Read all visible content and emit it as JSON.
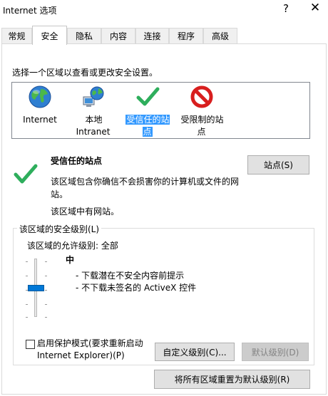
{
  "window": {
    "title": "Internet 选项",
    "help_glyph": "?",
    "close_glyph": "✕"
  },
  "tabs": [
    {
      "label": "常规",
      "active": false
    },
    {
      "label": "安全",
      "active": true
    },
    {
      "label": "隐私",
      "active": false
    },
    {
      "label": "内容",
      "active": false
    },
    {
      "label": "连接",
      "active": false
    },
    {
      "label": "程序",
      "active": false
    },
    {
      "label": "高级",
      "active": false
    }
  ],
  "zone_prompt": "选择一个区域以查看或更改安全设置。",
  "zones": [
    {
      "label": "Internet",
      "icon": "globe-icon",
      "selected": false
    },
    {
      "label": "本地 Intranet",
      "icon": "local-intranet-icon",
      "selected": false
    },
    {
      "label": "受信任的站点",
      "icon": "checkmark-icon",
      "selected": true
    },
    {
      "label": "受限制的站点",
      "icon": "no-entry-icon",
      "selected": false
    }
  ],
  "selected_zone": {
    "title": "受信任的站点",
    "description": "该区域包含你确信不会损害你的计算机或文件的网站。",
    "sites_note": "该区域中有网站。",
    "sites_button": "站点(S)"
  },
  "security_level": {
    "group_label": "该区域的安全级别(L)",
    "allowed_levels": "该区域的允许级别: 全部",
    "level_name": "中",
    "level_items": [
      "- 下载潜在不安全内容前提示",
      "- 不下载未签名的 ActiveX 控件"
    ],
    "slider_level": 0.5,
    "protected_mode_label": "启用保护模式(要求重新启动 Internet Explorer)(P)",
    "protected_mode_checked": false,
    "custom_button": "自定义级别(C)...",
    "default_button": "默认级别(D)",
    "reset_all_button": "将所有区域重置为默认级别(R)"
  },
  "colors": {
    "selection": "#3399ff",
    "slider_thumb": "#0078d7",
    "check_green": "#2eae5c",
    "restricted_red": "#d81e1e"
  }
}
